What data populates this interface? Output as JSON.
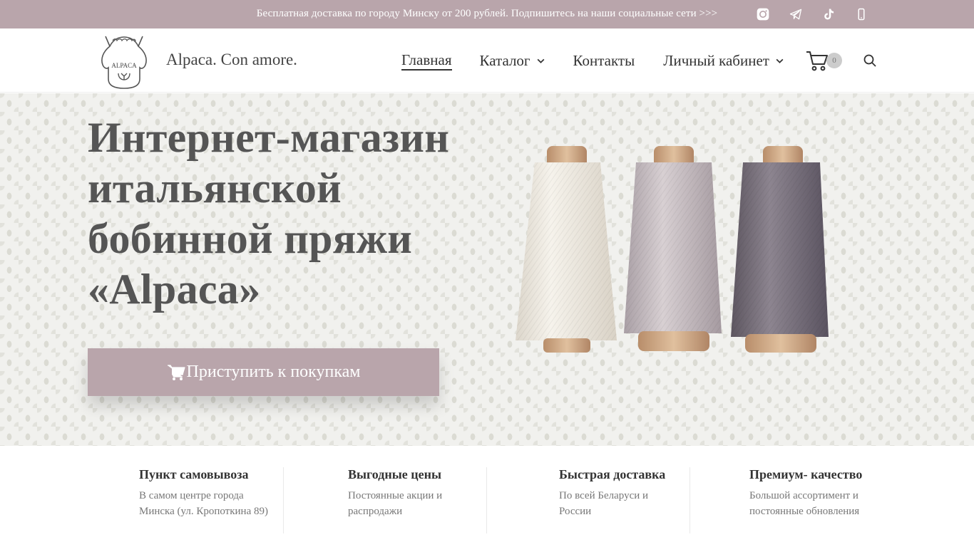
{
  "topbar": {
    "text": "Бесплатная доставка по городу Минску от 200 рублей. Подпишитесь на наши социальные сети >>>",
    "socials": [
      "instagram-icon",
      "telegram-icon",
      "tiktok-icon",
      "phone-icon"
    ]
  },
  "header": {
    "logo_text": "ALPACA",
    "brand": "Alpaca. Con amore.",
    "nav": [
      {
        "label": "Главная",
        "active": true
      },
      {
        "label": "Каталог",
        "dropdown": true
      },
      {
        "label": "Контакты"
      },
      {
        "label": "Личный кабинет",
        "dropdown": true
      }
    ],
    "cart_count": "0"
  },
  "hero": {
    "title_lines": [
      "Интернет-магазин",
      "итальянской",
      "бобинной пряжи",
      "«Alpaca»"
    ],
    "button_label": "Приступить к покупкам"
  },
  "features": [
    {
      "title": "Пункт самовывоза",
      "text_lines": [
        "В самом центре города",
        "Минска (ул. Кропоткина 89)"
      ]
    },
    {
      "title": "Выгодные цены",
      "text_lines": [
        "Постоянные акции и",
        "распродажи"
      ]
    },
    {
      "title": "Быстрая доставка",
      "text_lines": [
        "По всей Беларуси и",
        "России"
      ]
    },
    {
      "title": "Премиум- качество",
      "text_lines": [
        "Большой ассортимент и",
        "постоянные обновления"
      ]
    }
  ],
  "colors": {
    "accent": "#b9a5ab",
    "spool_colors": [
      "#efebe3",
      "#c9bfc3",
      "#77707a"
    ]
  }
}
